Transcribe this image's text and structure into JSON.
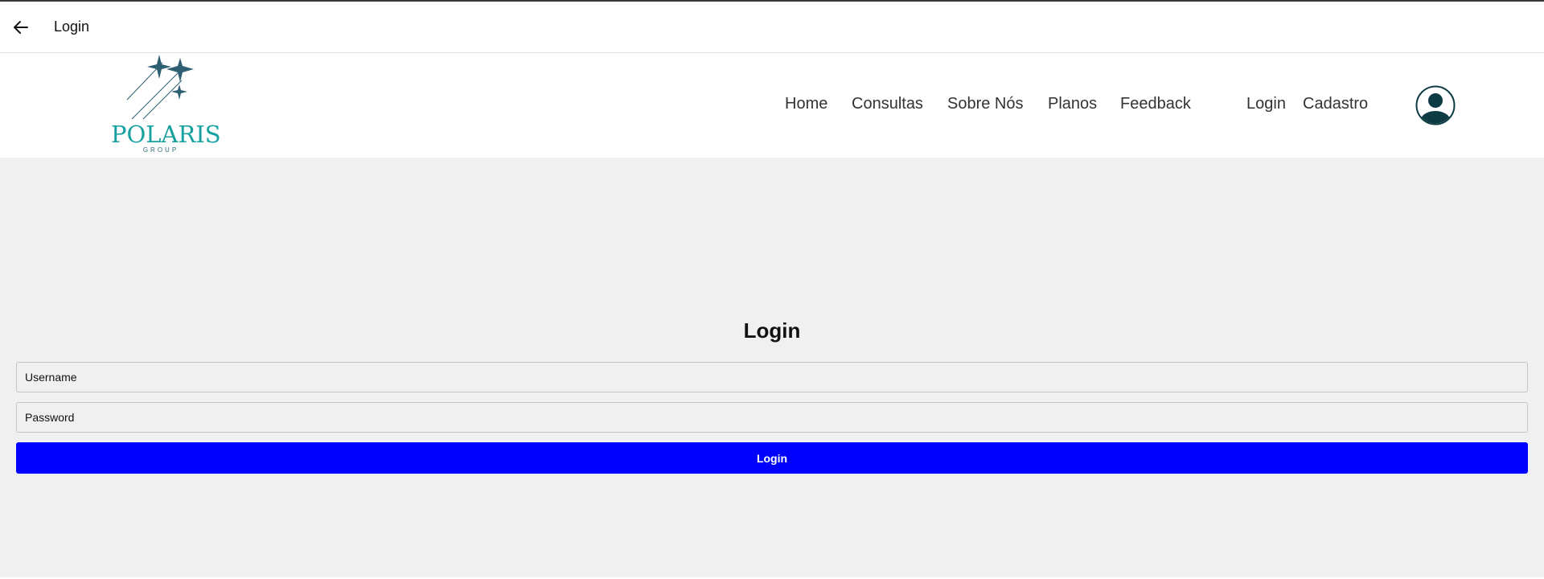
{
  "appbar": {
    "back_icon": "arrow-left-icon",
    "title": "Login"
  },
  "brand": {
    "name": "POLARIS",
    "tagline": "GROUP",
    "color": "#17a0a0"
  },
  "nav": {
    "items": [
      {
        "label": "Home"
      },
      {
        "label": "Consultas"
      },
      {
        "label": "Sobre Nós"
      },
      {
        "label": "Planos"
      },
      {
        "label": "Feedback"
      },
      {
        "label": "Login"
      },
      {
        "label": "Cadastro"
      }
    ],
    "profile_icon": "user-avatar-icon"
  },
  "form": {
    "title": "Login",
    "username_placeholder": "Username",
    "password_placeholder": "Password",
    "submit_label": "Login",
    "submit_color": "#0000ff"
  }
}
